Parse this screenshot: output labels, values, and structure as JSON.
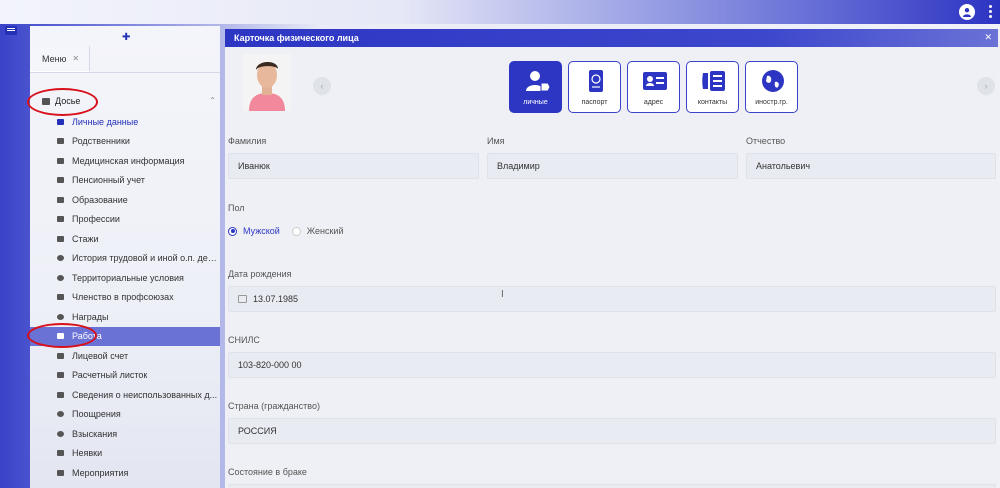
{
  "sidebar": {
    "tab_label": "Меню",
    "group_label": "Досье",
    "items": [
      {
        "label": "Личные данные",
        "icon": "id-card-icon"
      },
      {
        "label": "Родственники",
        "icon": "users-icon"
      },
      {
        "label": "Медицинская информация",
        "icon": "medical-doc-icon"
      },
      {
        "label": "Пенсионный учет",
        "icon": "glasses-icon"
      },
      {
        "label": "Образование",
        "icon": "education-icon"
      },
      {
        "label": "Профессии",
        "icon": "tools-icon"
      },
      {
        "label": "Стажи",
        "icon": "list-icon"
      },
      {
        "label": "История трудовой и иной о.п. дея...",
        "icon": "history-icon"
      },
      {
        "label": "Территориальные условия",
        "icon": "globe-icon"
      },
      {
        "label": "Членство в профсоюзах",
        "icon": "user-group-icon"
      },
      {
        "label": "Награды",
        "icon": "award-icon"
      },
      {
        "label": "Работа",
        "icon": "work-icon"
      },
      {
        "label": "Лицевой счет",
        "icon": "document-icon"
      },
      {
        "label": "Расчетный листок",
        "icon": "document-icon"
      },
      {
        "label": "Сведения о неиспользованных д...",
        "icon": "beach-icon"
      },
      {
        "label": "Поощрения",
        "icon": "smile-icon"
      },
      {
        "label": "Взыскания",
        "icon": "sad-icon"
      },
      {
        "label": "Неявки",
        "icon": "document-icon"
      },
      {
        "label": "Мероприятия",
        "icon": "calendar-icon"
      }
    ]
  },
  "panel": {
    "title": "Карточка физического лица",
    "tiles": [
      {
        "label": "личные",
        "icon": "person-tag-icon"
      },
      {
        "label": "паспорт",
        "icon": "passport-icon"
      },
      {
        "label": "адрес",
        "icon": "address-card-icon"
      },
      {
        "label": "контакты",
        "icon": "phone-icon"
      },
      {
        "label": "иностр.гр.",
        "icon": "globe-icon"
      }
    ],
    "form": {
      "surname_label": "Фамилия",
      "surname_value": "Иванюк",
      "name_label": "Имя",
      "name_value": "Владимир",
      "patronymic_label": "Отчество",
      "patronymic_value": "Анатольевич",
      "gender_label": "Пол",
      "gender_male": "Мужской",
      "gender_female": "Женский",
      "birthdate_label": "Дата рождения",
      "birthdate_value": "13.07.1985",
      "snils_label": "СНИЛС",
      "snils_value": "103-820-000 00",
      "country_label": "Страна (гражданство)",
      "country_value": "РОССИЯ",
      "marital_label": "Состояние в браке"
    }
  },
  "colors": {
    "accent": "#2d36c3",
    "active_item": "#6a72d6",
    "annotation": "#d8101a"
  }
}
